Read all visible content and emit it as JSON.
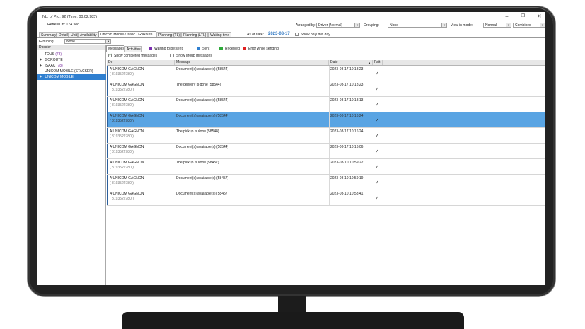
{
  "window": {
    "title": "Nb. of Pro: 92 (Time: 00:02.985)",
    "refresh": "Refresh in: 174 sec."
  },
  "toolbar": {
    "arranged_by_label": "Arranged by:",
    "arranged_by_value": "Driver (Normal)",
    "grouping_label": "Grouping:",
    "grouping_value": "None",
    "view_mode_label": "View in mode:",
    "view_mode_value": "Normal",
    "combined_value": "Combined"
  },
  "tabs": [
    {
      "label": "Summary"
    },
    {
      "label": "Detail"
    },
    {
      "label": "Unit"
    },
    {
      "label": "Availability"
    },
    {
      "label": "Unicom Mobile / Isaac / GoRoute"
    },
    {
      "label": "Planning (TL)"
    },
    {
      "label": "Planning (LTL)"
    },
    {
      "label": "Waiting time"
    }
  ],
  "as_of": {
    "label": "As of date:",
    "date": "2023-08-17",
    "show_only_label": "Show only this day"
  },
  "left": {
    "grouping_label": "Grouping:",
    "grouping_value": "None",
    "header": "Dossier",
    "items": [
      {
        "label": "TOUS",
        "count": "(78)"
      },
      {
        "label": "GOROUTE",
        "count": ""
      },
      {
        "label": "ISAAC",
        "count": "(78)"
      },
      {
        "label": "UNICOM MOBILE (STACKER)",
        "count": ""
      },
      {
        "label": "UNICOM MOBILE",
        "count": ""
      }
    ]
  },
  "subtabs": [
    {
      "label": "Messages"
    },
    {
      "label": "Activities"
    }
  ],
  "legend": [
    {
      "label": "Waiting to be sent",
      "color": "#7b2fb0"
    },
    {
      "label": "Sent",
      "color": "#2f7fd0"
    },
    {
      "label": "Received",
      "color": "#2eaa3a"
    },
    {
      "label": "Error while sending",
      "color": "#e02020"
    }
  ],
  "options": {
    "show_completed": "Show completed messages",
    "show_group": "Show group messages"
  },
  "grid": {
    "headers": {
      "from": "De",
      "message": "Message",
      "date": "Date",
      "done": "Fait"
    },
    "rows": [
      {
        "from": "A UNICOM GAGNON",
        "phone": "( 8193522780 )",
        "message": "Document(s) available(s) (58544)",
        "date": "2023-08-17 10:18:23"
      },
      {
        "from": "A UNICOM GAGNON",
        "phone": "( 8193522780 )",
        "message": "The delivery is done (58544)",
        "date": "2023-08-17 10:18:23"
      },
      {
        "from": "A UNICOM GAGNON",
        "phone": "( 8193522780 )",
        "message": "Document(s) available(s) (58544)",
        "date": "2023-08-17 10:18:13"
      },
      {
        "from": "A UNICOM GAGNON",
        "phone": "( 8193522780 )",
        "message": "Document(s) available(s) (58544)",
        "date": "2023-08-17 10:16:24"
      },
      {
        "from": "A UNICOM GAGNON",
        "phone": "( 8193522780 )",
        "message": "The pickup is done (58544)",
        "date": "2023-08-17 10:16:24"
      },
      {
        "from": "A UNICOM GAGNON",
        "phone": "( 8193522780 )",
        "message": "Document(s) available(s) (58544)",
        "date": "2023-08-17 10:16:06"
      },
      {
        "from": "A UNICOM GAGNON",
        "phone": "( 8193522780 )",
        "message": "The pickup is done (58457)",
        "date": "2023-08-10 10:59:22"
      },
      {
        "from": "A UNICOM GAGNON",
        "phone": "( 8193522780 )",
        "message": "Document(s) available(s) (58457)",
        "date": "2023-08-10 10:59:19"
      },
      {
        "from": "A UNICOM GAGNON",
        "phone": "( 8193522780 )",
        "message": "Document(s) available(s) (58457)",
        "date": "2023-08-10 10:58:41"
      }
    ]
  }
}
